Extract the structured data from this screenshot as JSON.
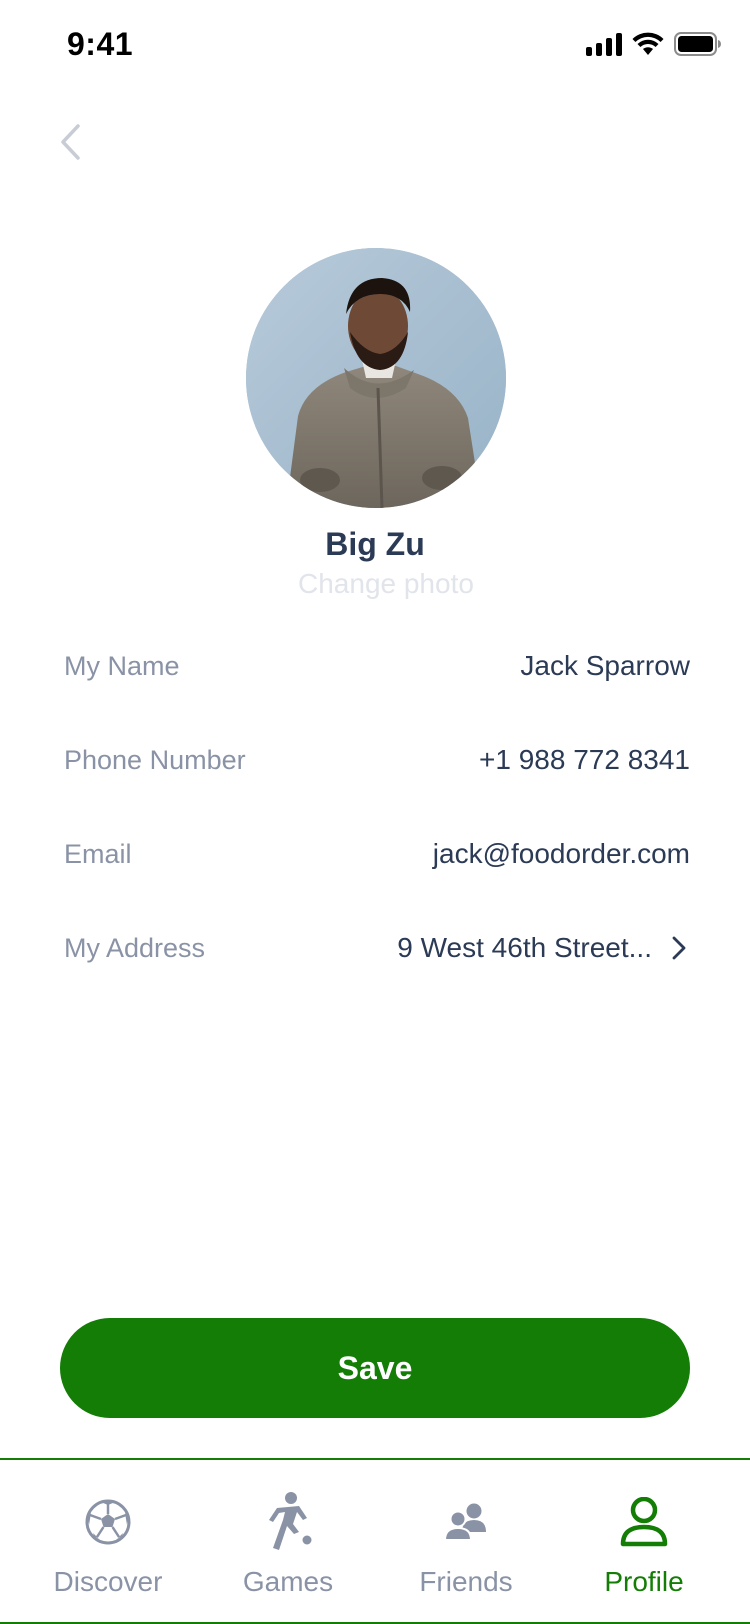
{
  "status_bar": {
    "time": "9:41"
  },
  "profile": {
    "display_name": "Big Zu",
    "change_photo_label": "Change photo"
  },
  "fields": [
    {
      "label": "My Name",
      "value": "Jack Sparrow"
    },
    {
      "label": "Phone Number",
      "value": "+1 988 772 8341"
    },
    {
      "label": "Email",
      "value": "jack@foodorder.com"
    },
    {
      "label": "My Address",
      "value": "9 West 46th Street..."
    }
  ],
  "actions": {
    "save_label": "Save"
  },
  "tab_bar": {
    "active": "Profile",
    "tabs": [
      {
        "label": "Discover",
        "icon": "soccer-ball-icon"
      },
      {
        "label": "Games",
        "icon": "player-kicking-icon"
      },
      {
        "label": "Friends",
        "icon": "friends-icon"
      },
      {
        "label": "Profile",
        "icon": "person-icon"
      }
    ]
  },
  "colors": {
    "accent": "#137d06",
    "text_primary": "#2b3a55",
    "text_secondary": "#8a93a6",
    "inactive_icon": "#8a93a6"
  }
}
